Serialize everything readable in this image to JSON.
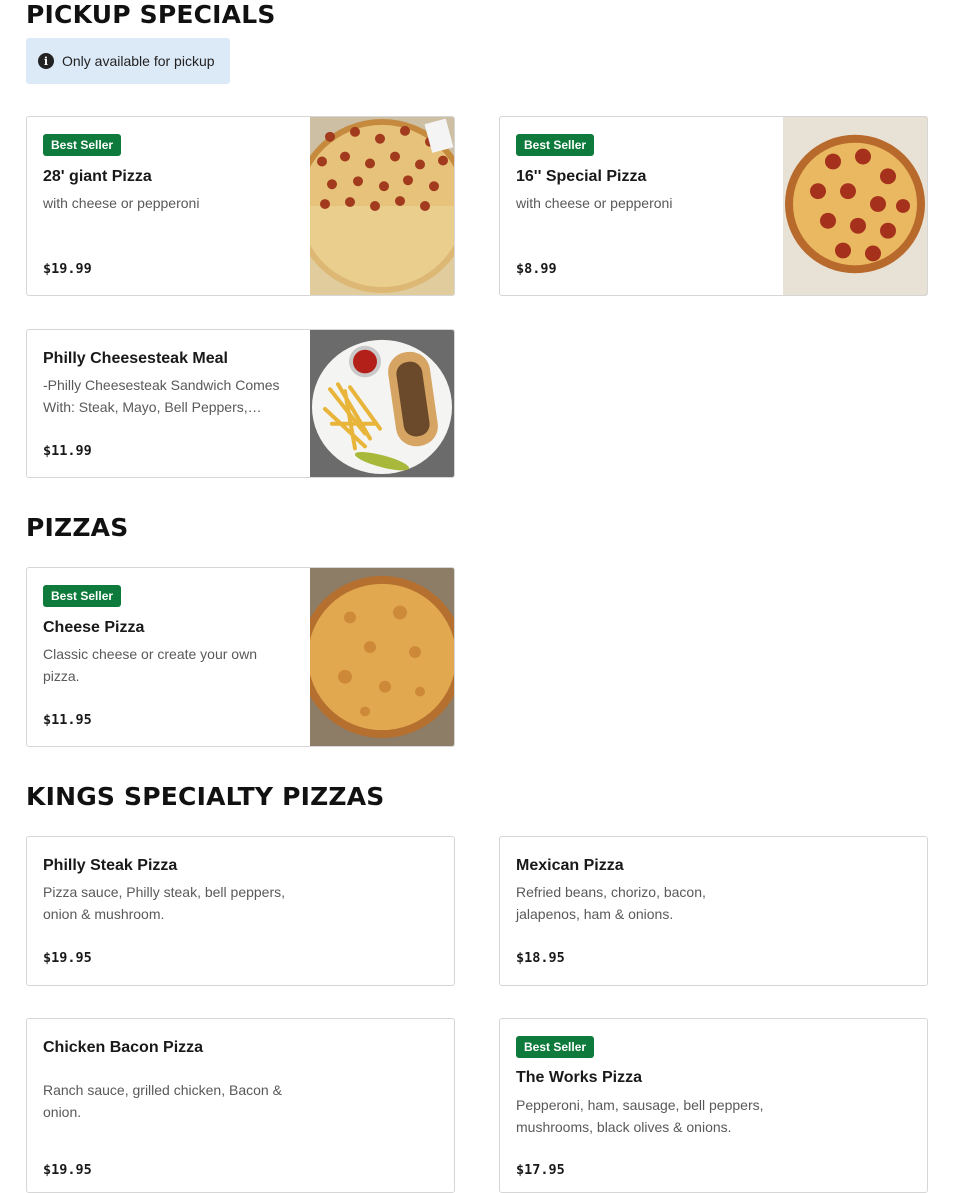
{
  "sections": {
    "pickup": {
      "title": "PICKUP SPECIALS",
      "note": "Only available for pickup",
      "items": [
        {
          "badge": "Best Seller",
          "name": "28' giant Pizza",
          "desc": "with cheese or pepperoni",
          "price": "$19.99",
          "image": "giant-pizza-image"
        },
        {
          "badge": "Best Seller",
          "name": "16'' Special Pizza",
          "desc": "with cheese or pepperoni",
          "price": "$8.99",
          "image": "pepperoni-pizza-image"
        },
        {
          "name": "Philly Cheesesteak Meal",
          "desc": "-Philly Cheesesteak Sandwich Comes With: Steak, Mayo, Bell Peppers,…",
          "price": "$11.99",
          "image": "cheesesteak-meal-image"
        }
      ]
    },
    "pizzas": {
      "title": "PIZZAS",
      "items": [
        {
          "badge": "Best Seller",
          "name": "Cheese Pizza",
          "desc": "Classic cheese or create your own pizza.",
          "price": "$11.95",
          "image": "cheese-pizza-image"
        }
      ]
    },
    "kings": {
      "title": "KINGS SPECIALTY PIZZAS",
      "items": [
        {
          "name": "Philly Steak Pizza",
          "desc": "Pizza sauce, Philly steak, bell peppers, onion & mushroom.",
          "price": "$19.95"
        },
        {
          "name": "Mexican Pizza",
          "desc": "Refried beans, chorizo, bacon, jalapenos, ham & onions.",
          "price": "$18.95"
        },
        {
          "name": "Chicken Bacon Pizza",
          "desc": "Ranch sauce, grilled chicken, Bacon & onion.",
          "price": "$19.95"
        },
        {
          "badge": "Best Seller",
          "name": "The Works Pizza",
          "desc": "Pepperoni, ham, sausage, bell peppers, mushrooms, black olives & onions.",
          "price": "$17.95"
        }
      ]
    }
  },
  "colors": {
    "badge": "#0e7a3b",
    "note_bg": "#dce9f7",
    "border": "#d6d6d6"
  }
}
